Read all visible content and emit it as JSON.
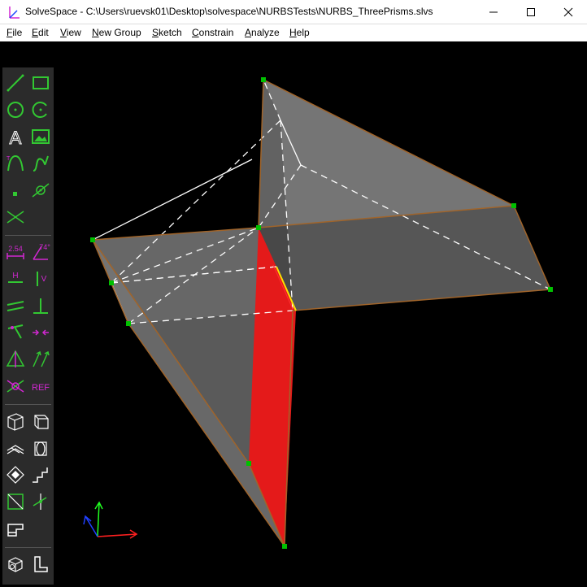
{
  "window": {
    "title": "SolveSpace - C:\\Users\\ruevsk01\\Desktop\\solvespace\\NURBSTests\\NURBS_ThreePrisms.slvs",
    "controls": [
      "minimize-icon",
      "maximize-icon",
      "close-icon"
    ]
  },
  "menu": {
    "file": "File",
    "edit": "Edit",
    "view": "View",
    "new_group": "New Group",
    "sketch": "Sketch",
    "constrain": "Constrain",
    "analyze": "Analyze",
    "help": "Help"
  },
  "toolbar": {
    "dimension_label": "2.54",
    "angle_label": "74°",
    "horizontal_label": "H",
    "vertical_label": "V",
    "reference_label": "REF",
    "tools": [
      "line-icon",
      "rectangle-icon",
      "circle-icon",
      "arc-icon",
      "text-icon",
      "image-icon",
      "tangent-arc-icon",
      "cubic-spline-icon",
      "point-icon",
      "workplane-icon",
      "construction-icon",
      "distance-icon",
      "angle-icon",
      "horizontal-icon",
      "vertical-icon",
      "parallel-icon",
      "perpendicular-icon",
      "point-on-entity-icon",
      "coincident-icon",
      "symmetric-icon",
      "same-orientation-icon",
      "other-supplementary-icon",
      "reference-icon",
      "nearest-iso-icon",
      "nearest-ortho-icon",
      "extrude-icon",
      "lathe-icon",
      "step-rotate-icon",
      "step-translate-icon",
      "workplane-group-icon",
      "sketch-in-3d-icon",
      "assemble-icon",
      "revolve-icon",
      "helix-icon"
    ]
  },
  "colors": {
    "background": "#000000",
    "face": "#7a7a7a",
    "edge": "#a0642a",
    "selected_face": "#e41a1a",
    "point": "#00c000",
    "hidden_edge": "#ffffff",
    "toolbar_bg": "#2b2b2b",
    "icon_green": "#32c832",
    "icon_magenta": "#d228d2"
  }
}
